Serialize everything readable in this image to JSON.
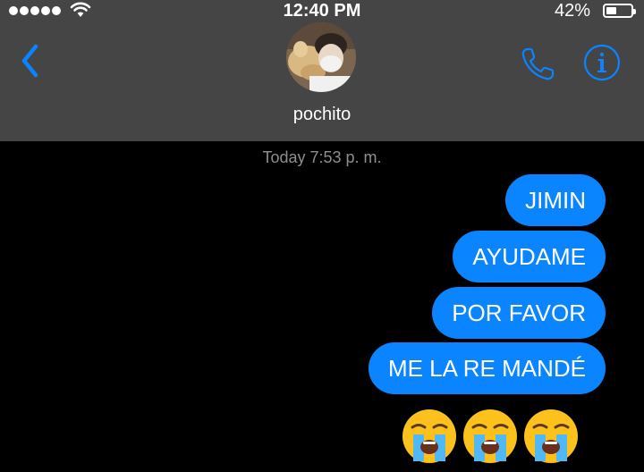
{
  "status_bar": {
    "signal_dots": 5,
    "time": "12:40 PM",
    "battery_percent_label": "42%",
    "battery_level": 0.42
  },
  "header": {
    "contact_name": "pochito",
    "accent_color": "#0a84ff",
    "background_color": "#454545"
  },
  "conversation": {
    "timestamp": "Today 7:53 p. m.",
    "messages": [
      {
        "text": "JIMIN",
        "sender": "me"
      },
      {
        "text": "AYUDAME",
        "sender": "me"
      },
      {
        "text": "POR FAVOR",
        "sender": "me"
      },
      {
        "text": "ME LA RE MANDÉ",
        "sender": "me"
      }
    ],
    "emoji_message": [
      "loudly-crying-face-icon",
      "loudly-crying-face-icon",
      "loudly-crying-face-icon"
    ],
    "bubble_color": "#0a84ff"
  }
}
